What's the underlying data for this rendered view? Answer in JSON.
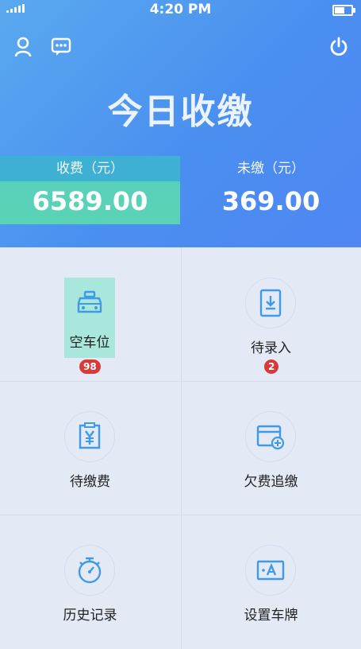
{
  "status_bar": {
    "time": "4:20 PM",
    "battery_level": 0.6
  },
  "header": {
    "title": "今日收缴",
    "paid_label": "收费（元）",
    "paid_value": "6589.00",
    "unpaid_label": "未缴（元）",
    "unpaid_value": "369.00"
  },
  "icons": {
    "profile": "user-icon",
    "messages": "message-icon",
    "power": "power-icon"
  },
  "menu": {
    "items": [
      {
        "label": "空车位",
        "badge": "98",
        "icon": "car-icon"
      },
      {
        "label": "待录入",
        "badge": "2",
        "icon": "tablet-download-icon"
      },
      {
        "label": "待缴费",
        "icon": "yuan-bill-icon"
      },
      {
        "label": "欠费追缴",
        "icon": "card-plus-icon"
      },
      {
        "label": "历史记录",
        "icon": "stopwatch-icon"
      },
      {
        "label": "设置车牌",
        "icon": "license-plate-icon"
      }
    ]
  },
  "colors": {
    "accent": "#4a8ff0",
    "teal": "#59d0ba",
    "badge": "#d83a3a",
    "icon_blue": "#3f9ae8"
  }
}
